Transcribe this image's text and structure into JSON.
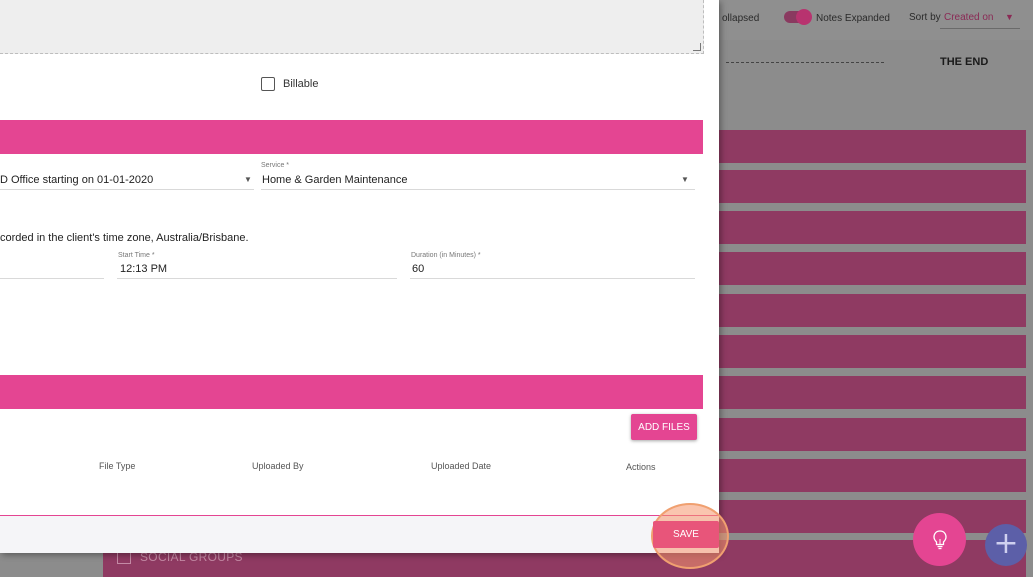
{
  "background": {
    "toggle_left_label": "ollapsed",
    "toggle_right_label": "Notes Expanded",
    "sort_label": "Sort by",
    "sort_value": "Created on",
    "the_end": "THE END",
    "social_groups": "SOCIAL GROUPS"
  },
  "form": {
    "billable_label": "Billable",
    "agreement_value": "D Office starting on 01-01-2020",
    "service_label": "Service *",
    "service_value": "Home & Garden Maintenance",
    "timezone_notice": "corded in the client's time zone, Australia/Brisbane.",
    "start_time_label": "Start Time *",
    "start_time_value": "12:13 PM",
    "duration_label": "Duration (in Minutes) *",
    "duration_value": "60"
  },
  "files": {
    "add_files_label": "ADD FILES",
    "columns": [
      "File Type",
      "Uploaded By",
      "Uploaded Date",
      "Actions"
    ]
  },
  "footer": {
    "save_label": "SAVE"
  },
  "colors": {
    "accent": "#e44592",
    "save": "#e8557a",
    "fab_secondary": "#5c5fa8"
  },
  "icons": [
    "lightbulb-icon",
    "plus-icon",
    "chevron-down-icon",
    "checkbox-icon"
  ]
}
